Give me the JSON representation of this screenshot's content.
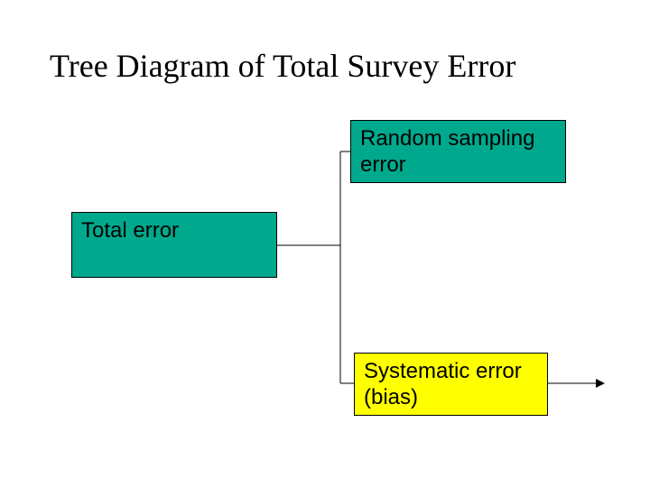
{
  "title": "Tree Diagram of Total Survey Error",
  "nodes": {
    "total": "Total error",
    "random": "Random sampling error",
    "systematic": "Systematic error (bias)"
  }
}
